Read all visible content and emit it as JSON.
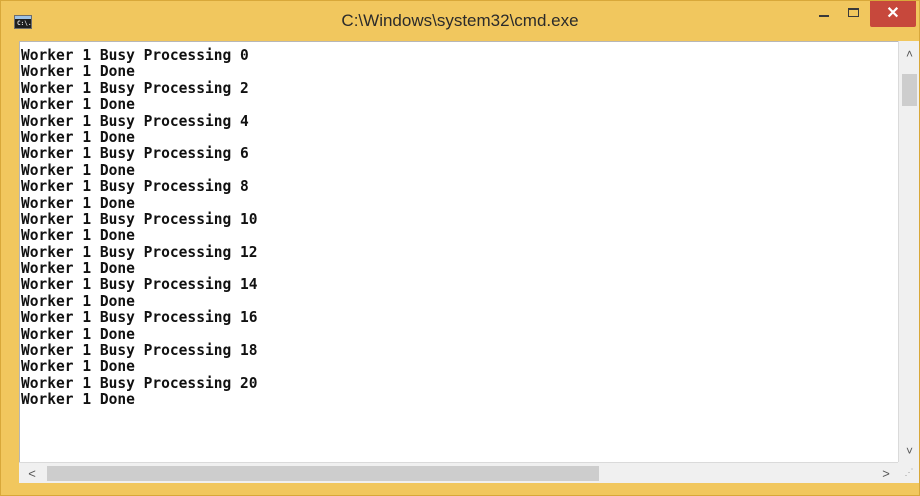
{
  "window": {
    "title": "C:\\Windows\\system32\\cmd.exe",
    "frame_color": "#f1c75e",
    "close_color": "#c7483c",
    "icon": "cmd-app-icon",
    "icon_glyph": "C:\\."
  },
  "controls": {
    "minimize_icon": "minimize-icon",
    "maximize_icon": "maximize-icon",
    "close_label": "✕"
  },
  "console": {
    "lines": [
      "Worker 1 Busy Processing 0",
      "Worker 1 Done",
      "Worker 1 Busy Processing 2",
      "Worker 1 Done",
      "Worker 1 Busy Processing 4",
      "Worker 1 Done",
      "Worker 1 Busy Processing 6",
      "Worker 1 Done",
      "Worker 1 Busy Processing 8",
      "Worker 1 Done",
      "Worker 1 Busy Processing 10",
      "Worker 1 Done",
      "Worker 1 Busy Processing 12",
      "Worker 1 Done",
      "Worker 1 Busy Processing 14",
      "Worker 1 Done",
      "Worker 1 Busy Processing 16",
      "Worker 1 Done",
      "Worker 1 Busy Processing 18",
      "Worker 1 Done",
      "Worker 1 Busy Processing 20",
      "Worker 1 Done"
    ]
  },
  "scrollbars": {
    "up_arrow": "˄",
    "down_arrow": "˅",
    "left_arrow": "<",
    "right_arrow": ">",
    "grip": "⋰"
  }
}
